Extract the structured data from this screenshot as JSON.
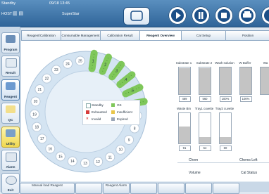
{
  "topbar": {
    "mode_text": "Standby",
    "datetime": "09/18 13:45",
    "host_text": "HOST",
    "system_name": "SuperStar"
  },
  "sidebar": {
    "items": [
      {
        "label": "Program",
        "icon": "program-icon"
      },
      {
        "label": "Result",
        "icon": "result-icon"
      },
      {
        "label": "Reagent",
        "icon": "reagent-icon",
        "active": true
      },
      {
        "label": "QC",
        "icon": "qc-icon"
      },
      {
        "label": "Utility",
        "icon": "utility-icon"
      },
      {
        "label": "Alarm",
        "icon": "alarm-icon"
      },
      {
        "label": "Exit",
        "icon": "exit-icon"
      }
    ]
  },
  "tabs": [
    {
      "label": "Reagent/Calibration"
    },
    {
      "label": "Consumable Management"
    },
    {
      "label": "Calibration Result"
    },
    {
      "label": "Reagent Overview",
      "selected": true
    },
    {
      "label": "Cal Setup"
    },
    {
      "label": "Position"
    }
  ],
  "carousel": {
    "positions": [
      "1",
      "2",
      "3",
      "4",
      "5",
      "6",
      "7",
      "8",
      "9",
      "10",
      "11",
      "12",
      "13",
      "14",
      "15",
      "16",
      "17",
      "18",
      "19",
      "20",
      "21",
      "22",
      "23",
      "24",
      "25"
    ],
    "ok_positions": [
      1,
      2,
      3,
      4,
      5,
      6
    ]
  },
  "legend": {
    "standby": "Standby",
    "ok": "OK",
    "exhausted": "Exhausted",
    "insufficient": "Insufficient",
    "invalid": "Invalid",
    "expired": "Expired"
  },
  "gauges_top": [
    {
      "label": "Substrate 1",
      "value": "469",
      "level": 0.97
    },
    {
      "label": "Substrate 2",
      "value": "560",
      "level": 0.97
    },
    {
      "label": "Wash solution",
      "value": "100%",
      "level": 1.0
    },
    {
      "label": "W Buffer",
      "value": "100%",
      "level": 1.0
    },
    {
      "label": "Wa",
      "value": "",
      "level": 1.0
    }
  ],
  "gauges_bottom": [
    {
      "label": "Waste Bin",
      "value": "91",
      "level": 0.55
    },
    {
      "label": "Tray1 cuvette",
      "value": "54",
      "level": 0.2
    },
    {
      "label": "Tray2 cuvette",
      "value": "60",
      "level": 0.2
    }
  ],
  "info": {
    "chem": "Chem",
    "chems_left": "Chems Left",
    "volume": "Volume",
    "cal_status": "Cal Status"
  },
  "bottombar": {
    "buttons": [
      {
        "label": "Manual load Reagent"
      },
      {
        "label": ""
      },
      {
        "label": "Reagent Alarm"
      },
      {
        "label": ""
      },
      {
        "label": ""
      },
      {
        "label": ""
      },
      {
        "label": ""
      }
    ]
  },
  "colors": {
    "ok": "#7fc75a",
    "standby": "#ffffff",
    "exhausted": "#d63c3c",
    "insufficient": "#e9c64a",
    "expired": "#9aa6b7",
    "header": "#3a6fa5"
  }
}
